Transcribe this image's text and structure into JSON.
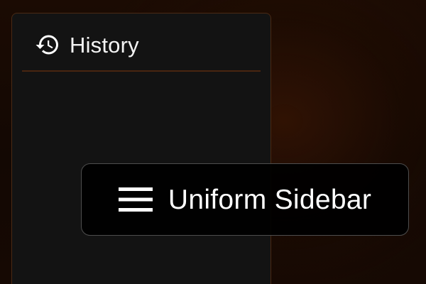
{
  "history_panel": {
    "title": "History",
    "icon": "history-icon"
  },
  "overlay": {
    "title": "Uniform Sidebar",
    "icon": "menu-icon"
  },
  "colors": {
    "panel_bg": "#131313",
    "panel_border": "#4a2a14",
    "divider": "#4a2610",
    "background_glow": "#461a04",
    "overlay_bg": "#000000",
    "overlay_border": "#4e4e4e",
    "text": "#ffffff"
  }
}
